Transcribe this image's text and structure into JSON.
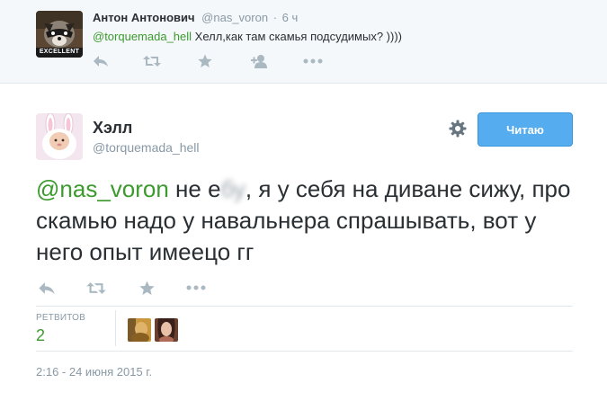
{
  "parent_tweet": {
    "fullname": "Антон Антонович",
    "username": "@nas_voron",
    "separator": "·",
    "time": "6 ч",
    "mention": "@torquemada_hell",
    "text": " Хелл,как там скамья подсудимых? ))))",
    "avatar_badge": "EXCELLENT",
    "actions": [
      "reply-icon",
      "retweet-icon",
      "favorite-icon",
      "follow-icon",
      "more-icon"
    ]
  },
  "main_tweet": {
    "fullname": "Хэлл",
    "username": "@torquemada_hell",
    "follow_label": "Читаю",
    "mention": "@nas_voron",
    "text_before_blur": " не е",
    "text_blurred": "бу",
    "text_after_blur": ", я у себя на диване сижу, про скамью надо у навальнера спрашывать, вот у него опыт имеецо гг",
    "actions": [
      "reply-icon",
      "retweet-icon",
      "favorite-icon",
      "more-icon"
    ],
    "stats": {
      "retweets_label": "РЕТВИТОВ",
      "retweets_count": "2"
    },
    "timestamp": "2:16 - 24 июня 2015 г."
  },
  "colors": {
    "mention": "#3c9a2e",
    "button": "#55acee",
    "muted": "#8899a6",
    "icon": "#aab8c2"
  }
}
